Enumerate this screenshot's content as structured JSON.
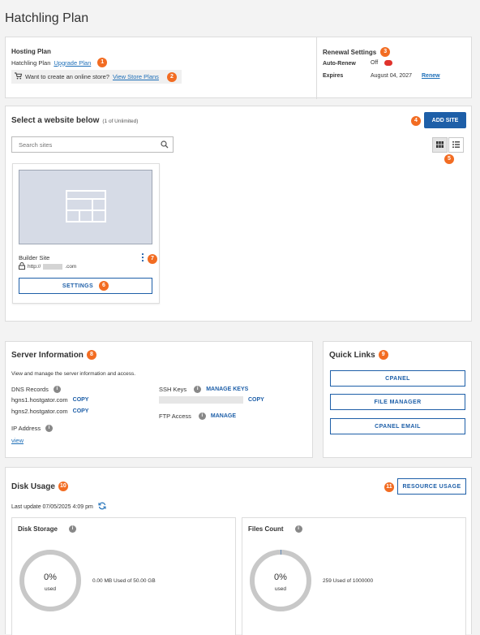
{
  "page": {
    "title": "Hatchling Plan"
  },
  "hosting": {
    "heading": "Hosting Plan",
    "plan_name": "Hatchling Plan",
    "upgrade_link": "Upgrade Plan",
    "badge1": "1",
    "store_prompt": "Want to create an online store?",
    "store_link": "View Store Plans",
    "badge2": "2"
  },
  "renewal": {
    "heading": "Renewal Settings",
    "badge": "3",
    "auto_renew_label": "Auto-Renew",
    "auto_renew_value": "Off",
    "expires_label": "Expires",
    "expires_value": "August 04, 2027",
    "renew_link": "Renew"
  },
  "sites": {
    "heading": "Select a website below",
    "count": "(1 of Unlimited)",
    "badge_add": "4",
    "add_button": "ADD SITE",
    "search_placeholder": "Search sites",
    "badge_view": "5",
    "site_name": "Builder Site",
    "site_url_prefix": "http://",
    "site_url_suffix": ".com",
    "badge_menu": "7",
    "settings_button": "SETTINGS",
    "badge_settings": "6"
  },
  "server": {
    "heading": "Server Information",
    "badge": "8",
    "description": "View and manage the server information and access.",
    "dns_label": "DNS Records",
    "dns1": "hgns1.hostgator.com",
    "dns2": "hgns2.hostgator.com",
    "copy_label": "COPY",
    "ip_label": "IP Address",
    "ip_link": "view",
    "ssh_label": "SSH Keys",
    "manage_keys": "MANAGE KEYS",
    "ftp_label": "FTP Access",
    "ftp_manage": "MANAGE"
  },
  "quick_links": {
    "heading": "Quick Links",
    "badge": "9",
    "links": [
      "CPANEL",
      "FILE MANAGER",
      "CPANEL EMAIL"
    ]
  },
  "disk": {
    "heading": "Disk Usage",
    "badge": "10",
    "resource_badge": "11",
    "resource_button": "RESOURCE USAGE",
    "last_update": "Last update 07/05/2025 4:09 pm",
    "storage": {
      "title": "Disk Storage",
      "percent": "0%",
      "used_label": "used",
      "detail": "0.00 MB Used of 50.00 GB",
      "fraction": 0
    },
    "files": {
      "title": "Files Count",
      "percent": "0%",
      "used_label": "used",
      "detail": "259 Used of 1000000",
      "fraction": 0.0003
    }
  },
  "colors": {
    "accent": "#1e5fa8",
    "badge": "#f26c22",
    "toggle_off": "#e0322b"
  }
}
